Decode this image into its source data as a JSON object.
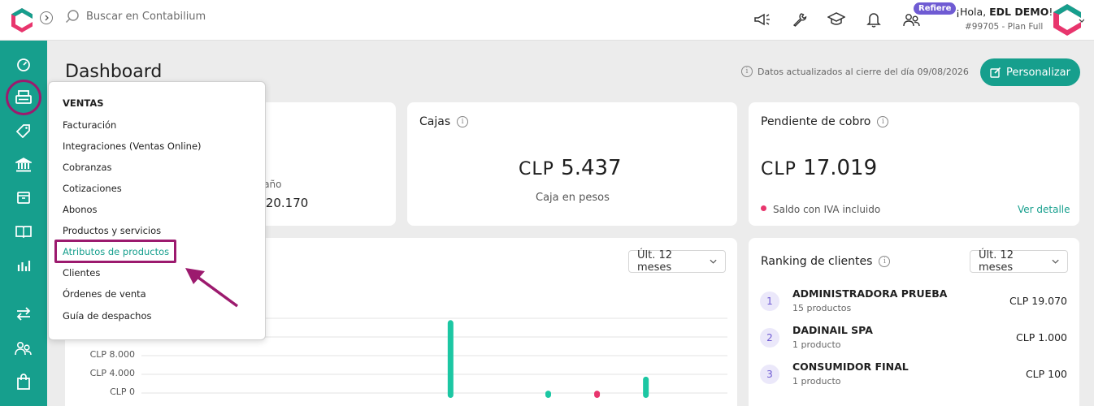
{
  "topbar": {
    "search_placeholder": "Buscar en Contabilium",
    "refiere_badge": "Refiere",
    "greeting_prefix": "¡Hola, ",
    "greeting_name": "EDL DEMO",
    "greeting_suffix": "!",
    "plan": "#99705 - Plan Full"
  },
  "page": {
    "title": "Dashboard",
    "updated_text": "Datos actualizados al cierre del día 09/08/2026",
    "customize_label": "Personalizar"
  },
  "ventas_card": {
    "partial_label": "e año",
    "partial_amount": "P 20.170"
  },
  "cajas_card": {
    "title": "Cajas",
    "currency": "CLP",
    "amount": "5.437",
    "subtitle": "Caja en pesos"
  },
  "pendiente_card": {
    "title": "Pendiente de cobro",
    "currency": "CLP",
    "amount": "17.019",
    "note": "Saldo con IVA incluido",
    "link": "Ver detalle"
  },
  "chart_card": {
    "period_select": "Últ. 12 meses"
  },
  "chart_data": {
    "type": "bar",
    "y_tick_labels": [
      "CLP 0",
      "CLP 4.000",
      "CLP 8.000"
    ],
    "ylim": [
      0,
      20000
    ],
    "grid": true,
    "bars": [
      {
        "index": 6,
        "value": 15600,
        "color": "#1cc7a3"
      },
      {
        "index": 8,
        "value": 500,
        "color": "#1cc7a3"
      },
      {
        "index": 9,
        "value": 500,
        "color": "#e8356d"
      },
      {
        "index": 10,
        "value": 3500,
        "color": "#1cc7a3"
      }
    ],
    "category_count": 12
  },
  "ranking": {
    "title": "Ranking de clientes",
    "period_select": "Últ. 12 meses",
    "rows": [
      {
        "rank": "1",
        "name": "ADMINISTRADORA PRUEBA",
        "detail": "15 productos",
        "amount": "CLP 19.070"
      },
      {
        "rank": "2",
        "name": "DADINAIL SPA",
        "detail": "1 producto",
        "amount": "CLP 1.000"
      },
      {
        "rank": "3",
        "name": "CONSUMIDOR FINAL",
        "detail": "1 producto",
        "amount": "CLP 100"
      }
    ]
  },
  "menu": {
    "heading": "VENTAS",
    "items": [
      "Facturación",
      "Integraciones (Ventas Online)",
      "Cobranzas",
      "Cotizaciones",
      "Abonos",
      "Productos y servicios",
      "Atributos de productos",
      "Clientes",
      "Órdenes de venta",
      "Guía de despachos"
    ]
  },
  "colors": {
    "brand_teal": "#169f8d",
    "highlight_magenta": "#9c1a6e",
    "badge_purple": "#6f5bd3",
    "logo_red": "#e8356d"
  }
}
